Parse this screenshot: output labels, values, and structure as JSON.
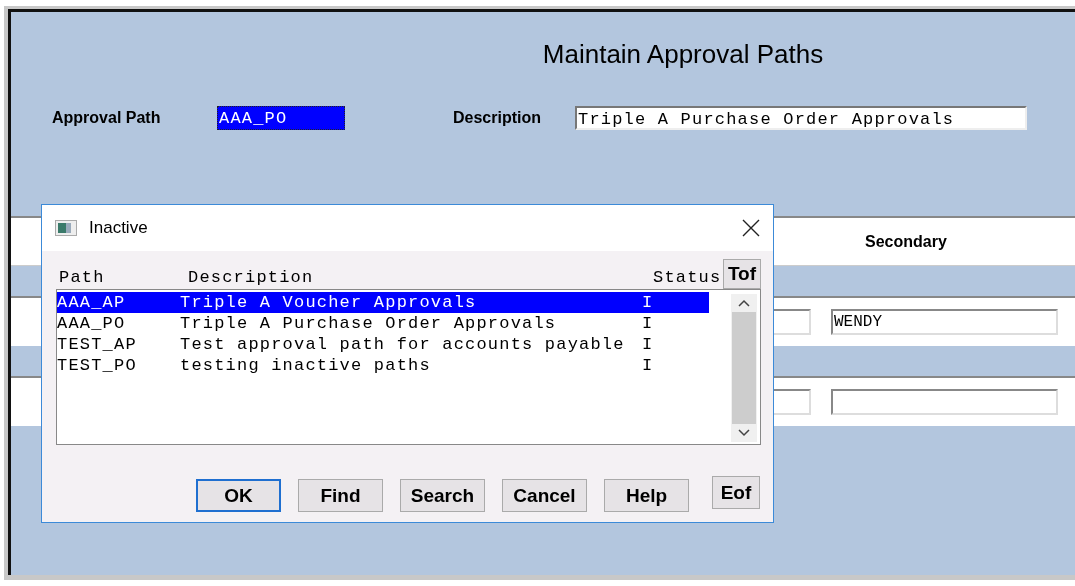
{
  "window": {
    "title": "Maintain Approval Paths"
  },
  "form": {
    "approval_path": {
      "label": "Approval Path",
      "value": "AAA_PO",
      "selected": true
    },
    "description": {
      "label": "Description",
      "value": "Triple A Purchase Order Approvals"
    }
  },
  "grid": {
    "header": "Secondary",
    "rows": [
      {
        "secondary": "WENDY"
      },
      {}
    ]
  },
  "dialog": {
    "title": "Inactive",
    "columns": [
      "Path",
      "Description",
      "Status"
    ],
    "top_button": "Tof",
    "rows": [
      {
        "path": "AAA_AP",
        "description": "Triple A Voucher Approvals",
        "status": "I",
        "selected": true
      },
      {
        "path": "AAA_PO",
        "description": "Triple A Purchase Order Approvals",
        "status": "I",
        "selected": false
      },
      {
        "path": "TEST_AP",
        "description": "Test approval path for accounts payable",
        "status": "I",
        "selected": false
      },
      {
        "path": "TEST_PO",
        "description": "testing inactive paths",
        "status": "I",
        "selected": false
      }
    ],
    "buttons": [
      {
        "label": "OK",
        "focused": true
      },
      {
        "label": "Find",
        "focused": false
      },
      {
        "label": "Search",
        "focused": false
      },
      {
        "label": "Cancel",
        "focused": false
      },
      {
        "label": "Help",
        "focused": false
      },
      {
        "label": "Eof",
        "focused": false
      }
    ]
  }
}
